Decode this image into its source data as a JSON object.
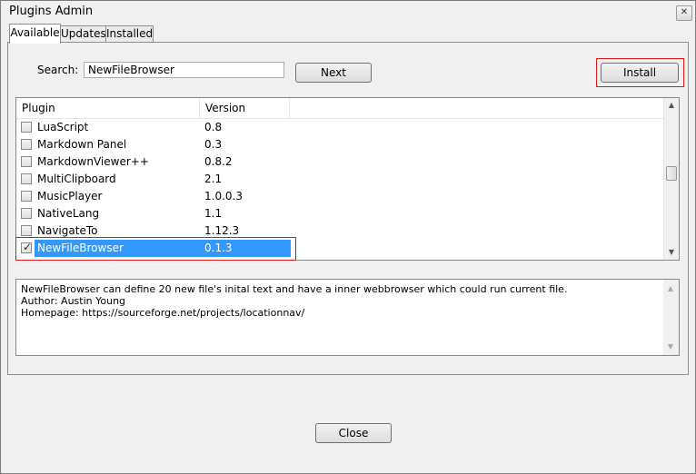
{
  "window": {
    "title": "Plugins Admin",
    "close_glyph": "✕"
  },
  "tabs": [
    {
      "label": "Available",
      "active": true
    },
    {
      "label": "Updates",
      "active": false
    },
    {
      "label": "Installed",
      "active": false
    }
  ],
  "search": {
    "label": "Search:",
    "value": "NewFileBrowser"
  },
  "buttons": {
    "next": "Next",
    "install": "Install",
    "close": "Close"
  },
  "list": {
    "columns": [
      "Plugin",
      "Version"
    ],
    "rows": [
      {
        "name": "LuaScript",
        "version": "0.8",
        "checked": false
      },
      {
        "name": "Markdown Panel",
        "version": "0.3",
        "checked": false
      },
      {
        "name": "MarkdownViewer++",
        "version": "0.8.2",
        "checked": false
      },
      {
        "name": "MultiClipboard",
        "version": "2.1",
        "checked": false
      },
      {
        "name": "MusicPlayer",
        "version": "1.0.0.3",
        "checked": false
      },
      {
        "name": "NativeLang",
        "version": "1.1",
        "checked": false
      },
      {
        "name": "NavigateTo",
        "version": "1.12.3",
        "checked": false
      },
      {
        "name": "NewFileBrowser",
        "version": "0.1.3",
        "checked": true,
        "selected": true
      }
    ]
  },
  "description": {
    "lines": [
      "NewFileBrowser can define 20 new file's inital text and have a inner webbrowser which could run current file.",
      "Author: Austin Young",
      "Homepage: https://sourceforge.net/projects/locationnav/"
    ]
  },
  "colors": {
    "highlight": "#e01a1a",
    "selection": "#3399ff"
  }
}
